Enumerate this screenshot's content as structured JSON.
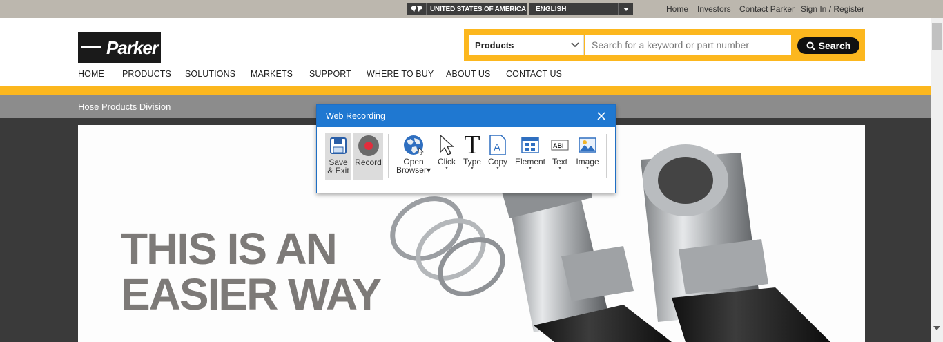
{
  "utility": {
    "region": "UNITED STATES OF AMERICA",
    "language": "ENGLISH",
    "links": [
      "Home",
      "Investors",
      "Contact Parker",
      "Sign In / Register"
    ]
  },
  "brand": {
    "logo_text": "Parker",
    "accent_color": "#fcb71e"
  },
  "search": {
    "category": "Products",
    "placeholder": "Search for a keyword or part number",
    "button_label": "Search"
  },
  "nav": [
    "HOME",
    "PRODUCTS",
    "SOLUTIONS",
    "MARKETS",
    "SUPPORT",
    "WHERE TO BUY",
    "ABOUT US",
    "CONTACT US"
  ],
  "division": "Hose Products Division",
  "hero": {
    "line1": "THIS IS AN",
    "line2": "EASIER WAY"
  },
  "recorder": {
    "title": "Web Recording",
    "title_color": "#1f78d1",
    "save": [
      "Save",
      "& Exit"
    ],
    "record": "Record",
    "tools": [
      {
        "label": "Open",
        "label2": "Browser",
        "icon": "globe-icon"
      },
      {
        "label": "Click",
        "icon": "cursor-icon"
      },
      {
        "label": "Type",
        "icon": "type-icon"
      },
      {
        "label": "Copy",
        "icon": "copy-icon"
      },
      {
        "label": "Element",
        "icon": "element-icon"
      },
      {
        "label": "Text",
        "icon": "text-icon"
      },
      {
        "label": "Image",
        "icon": "image-icon"
      }
    ]
  }
}
